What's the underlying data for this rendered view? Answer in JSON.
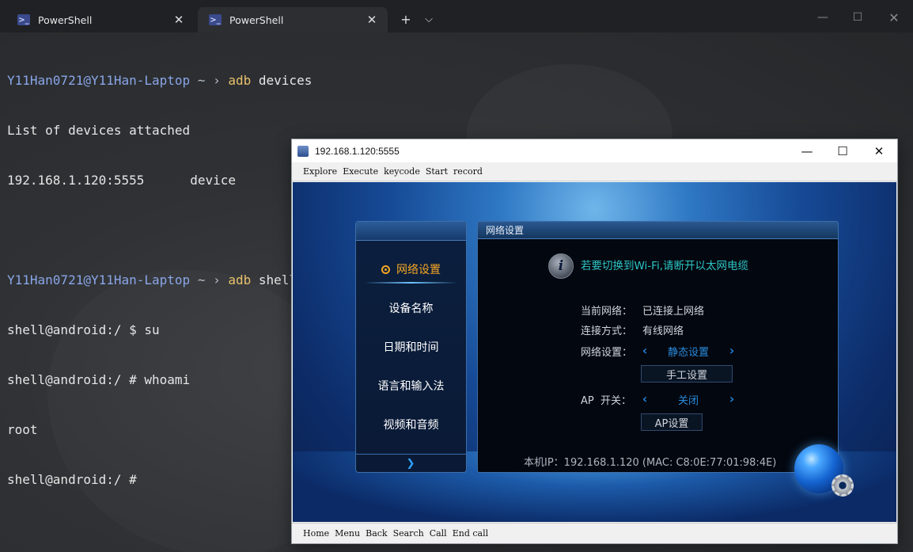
{
  "terminal": {
    "tabs": [
      {
        "label": "PowerShell"
      },
      {
        "label": "PowerShell"
      }
    ],
    "new_tab": "+",
    "dropdown": "⌄",
    "lines": [
      {
        "user": "Y11Han0721@Y11Han-Laptop",
        "tilde": " ~ ",
        "arrow": "› ",
        "exe": "adb",
        "args": " devices"
      },
      {
        "text": "List of devices attached"
      },
      {
        "text": "192.168.1.120:5555      device"
      },
      {
        "text": ""
      },
      {
        "user": "Y11Han0721@Y11Han-Laptop",
        "tilde": " ~ ",
        "arrow": "› ",
        "exe": "adb",
        "args": " shell"
      },
      {
        "text": "shell@android:/ $ su"
      },
      {
        "text": "shell@android:/ # whoami"
      },
      {
        "text": "root"
      },
      {
        "text": "shell@android:/ #"
      }
    ]
  },
  "emulator": {
    "title": "192.168.1.120:5555",
    "menu": [
      "Explore",
      "Execute",
      "keycode",
      "Start",
      "record"
    ],
    "bottom_bar": [
      "Home",
      "Menu",
      "Back",
      "Search",
      "Call",
      "End call"
    ],
    "left_menu": {
      "items": [
        {
          "label": "网络设置",
          "selected": true
        },
        {
          "label": "设备名称"
        },
        {
          "label": "日期和时间"
        },
        {
          "label": "语言和输入法"
        },
        {
          "label": "视频和音频"
        }
      ]
    },
    "settings": {
      "header": "网络设置",
      "notice": "若要切换到Wi-Fi,请断开以太网电缆",
      "current_network_label": "当前网络：",
      "current_network_value": "已连接上网络",
      "connection_label": "连接方式：",
      "connection_value": "有线网络",
      "network_setting_label": "网络设置：",
      "network_setting_value": "静态设置",
      "manual_button": "手工设置",
      "ap_switch_label": "AP  开关：",
      "ap_switch_value": "关闭",
      "ap_button": "AP设置",
      "ip_line": "本机IP：192.168.1.120 (MAC: C8:0E:77:01:98:4E)"
    }
  },
  "colors": {
    "prompt_user": "#8aa6e8",
    "command": "#e8c16c",
    "selected_menu": "#f5a623",
    "notice": "#2ec5c5",
    "choice": "#2a8bdc"
  }
}
